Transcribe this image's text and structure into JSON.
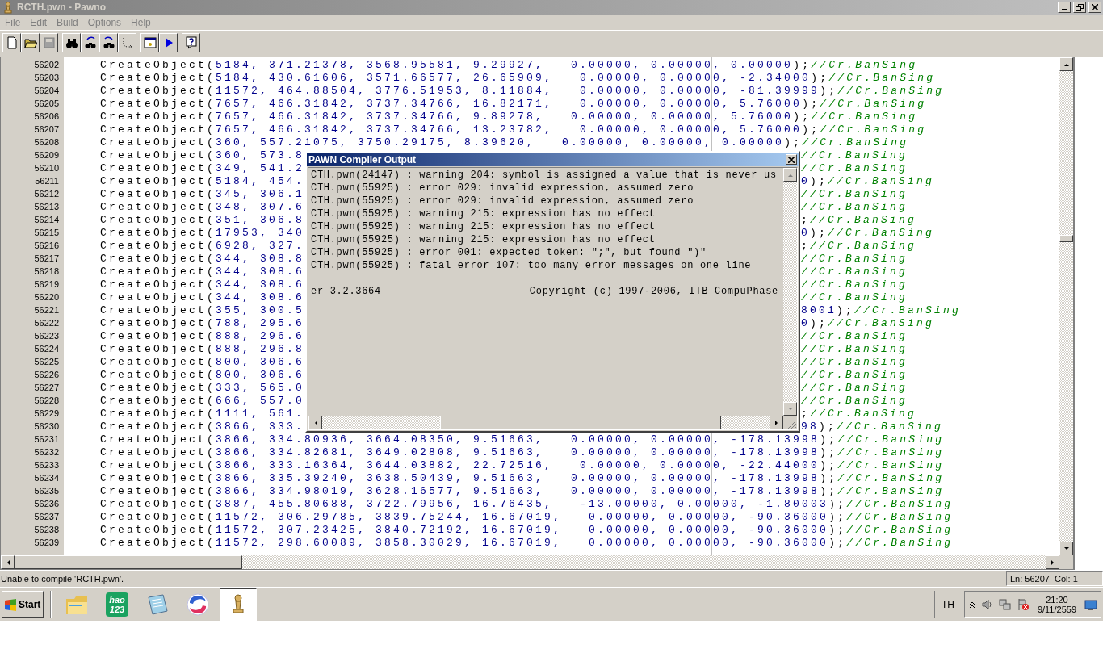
{
  "window": {
    "title": "RCTH.pwn - Pawno"
  },
  "menu": [
    "File",
    "Edit",
    "Build",
    "Options",
    "Help"
  ],
  "toolbar": [
    [
      {
        "kind": "new",
        "disabled": false
      },
      {
        "kind": "open",
        "disabled": false
      },
      {
        "kind": "save",
        "disabled": true
      }
    ],
    [
      {
        "kind": "find",
        "disabled": false
      },
      {
        "kind": "find-next",
        "disabled": false
      },
      {
        "kind": "replace",
        "disabled": false
      },
      {
        "kind": "goto",
        "disabled": false
      }
    ],
    [
      {
        "kind": "compile",
        "disabled": false
      },
      {
        "kind": "run",
        "disabled": false
      }
    ],
    [
      {
        "kind": "help",
        "disabled": false
      }
    ]
  ],
  "editor": {
    "lines": [
      {
        "number": "56202",
        "func": "CreateObject(",
        "args": "5184, 371.21378, 3568.95581, 9.29927,   0.00000, 0.00000, 0.00000",
        "end": ");",
        "comment": "//Cr.BanSing"
      },
      {
        "number": "56203",
        "func": "CreateObject(",
        "args": "5184, 430.61606, 3571.66577, 26.65909,   0.00000, 0.00000, -2.34000",
        "end": ");",
        "comment": "//Cr.BanSing"
      },
      {
        "number": "56204",
        "func": "CreateObject(",
        "args": "11572, 464.88504, 3776.51953, 8.11884,   0.00000, 0.00000, -81.39999",
        "end": ");",
        "comment": "//Cr.BanSing"
      },
      {
        "number": "56205",
        "func": "CreateObject(",
        "args": "7657, 466.31842, 3737.34766, 16.82171,   0.00000, 0.00000, 5.76000",
        "end": ");",
        "comment": "//Cr.BanSing"
      },
      {
        "number": "56206",
        "func": "CreateObject(",
        "args": "7657, 466.31842, 3737.34766, 9.89278,   0.00000, 0.00000, 5.76000",
        "end": ");",
        "comment": "//Cr.BanSing"
      },
      {
        "number": "56207",
        "func": "CreateObject(",
        "args": "7657, 466.31842, 3737.34766, 13.23782,   0.00000, 0.00000, 5.76000",
        "end": ");",
        "comment": "//Cr.BanSing"
      },
      {
        "number": "56208",
        "func": "CreateObject(",
        "args": "360, 557.21075, 3750.29175, 8.39620,   0.00000, 0.00000, 0.00000",
        "end": ");",
        "comment": "//Cr.BanSing"
      },
      {
        "number": "56209",
        "func": "CreateObject(",
        "args": "360, 573.8",
        "comment": "//Cr.BanSing"
      },
      {
        "number": "56210",
        "func": "CreateObject(",
        "args": "349, 541.2",
        "comment": "//Cr.BanSing"
      },
      {
        "number": "56211",
        "func": "CreateObject(",
        "args": "5184, 454.",
        "tail": {
          "args": "0",
          "end": ");"
        },
        "comment": "//Cr.BanSing"
      },
      {
        "number": "56212",
        "func": "CreateObject(",
        "args": "345, 306.1",
        "comment": "//Cr.BanSing"
      },
      {
        "number": "56213",
        "func": "CreateObject(",
        "args": "348, 307.6",
        "comment": "//Cr.BanSing"
      },
      {
        "number": "56214",
        "func": "CreateObject(",
        "args": "351, 306.8",
        "tail": {
          "end": ";"
        },
        "comment": "//Cr.BanSing"
      },
      {
        "number": "56215",
        "func": "CreateObject(",
        "args": "17953, 340",
        "tail": {
          "args": "0",
          "end": ");"
        },
        "comment": "//Cr.BanSing"
      },
      {
        "number": "56216",
        "func": "CreateObject(",
        "args": "6928, 327.",
        "tail": {
          "end": ";"
        },
        "comment": "//Cr.BanSing"
      },
      {
        "number": "56217",
        "func": "CreateObject(",
        "args": "344, 308.8",
        "comment": "//Cr.BanSing"
      },
      {
        "number": "56218",
        "func": "CreateObject(",
        "args": "344, 308.6",
        "comment": "//Cr.BanSing"
      },
      {
        "number": "56219",
        "func": "CreateObject(",
        "args": "344, 308.6",
        "comment": "//Cr.BanSing"
      },
      {
        "number": "56220",
        "func": "CreateObject(",
        "args": "344, 308.6",
        "comment": "//Cr.BanSing"
      },
      {
        "number": "56221",
        "func": "CreateObject(",
        "args": "355, 300.5",
        "tail": {
          "args": "8001",
          "end": ");"
        },
        "comment": "//Cr.BanSing"
      },
      {
        "number": "56222",
        "func": "CreateObject(",
        "args": "788, 295.6",
        "tail": {
          "args": "0",
          "end": ");"
        },
        "comment": "//Cr.BanSing"
      },
      {
        "number": "56223",
        "func": "CreateObject(",
        "args": "888, 296.6",
        "comment": "//Cr.BanSing"
      },
      {
        "number": "56224",
        "func": "CreateObject(",
        "args": "888, 296.8",
        "comment": "//Cr.BanSing"
      },
      {
        "number": "56225",
        "func": "CreateObject(",
        "args": "800, 306.6",
        "comment": "//Cr.BanSing"
      },
      {
        "number": "56226",
        "func": "CreateObject(",
        "args": "800, 306.6",
        "comment": "//Cr.BanSing"
      },
      {
        "number": "56227",
        "func": "CreateObject(",
        "args": "333, 565.0",
        "comment": "//Cr.BanSing"
      },
      {
        "number": "56228",
        "func": "CreateObject(",
        "args": "666, 557.0",
        "comment": "//Cr.BanSing"
      },
      {
        "number": "56229",
        "func": "CreateObject(",
        "args": "1111, 561.",
        "tail": {
          "end": ";"
        },
        "comment": "//Cr.BanSing"
      },
      {
        "number": "56230",
        "func": "CreateObject(",
        "args": "3866, 333.",
        "tail": {
          "args": "98",
          "end": ");"
        },
        "comment": "//Cr.BanSing"
      },
      {
        "number": "56231",
        "func": "CreateObject(",
        "args": "3866, 334.80936, 3664.08350, 9.51663,   0.00000, 0.00000, -178.13998",
        "end": ");",
        "comment": "//Cr.BanSing"
      },
      {
        "number": "56232",
        "func": "CreateObject(",
        "args": "3866, 334.82681, 3649.02808, 9.51663,   0.00000, 0.00000, -178.13998",
        "end": ");",
        "comment": "//Cr.BanSing"
      },
      {
        "number": "56233",
        "func": "CreateObject(",
        "args": "3866, 333.16364, 3644.03882, 22.72516,   0.00000, 0.00000, -22.44000",
        "end": ");",
        "comment": "//Cr.BanSing"
      },
      {
        "number": "56234",
        "func": "CreateObject(",
        "args": "3866, 335.39240, 3638.50439, 9.51663,   0.00000, 0.00000, -178.13998",
        "end": ");",
        "comment": "//Cr.BanSing"
      },
      {
        "number": "56235",
        "func": "CreateObject(",
        "args": "3866, 334.98019, 3628.16577, 9.51663,   0.00000, 0.00000, -178.13998",
        "end": ");",
        "comment": "//Cr.BanSing"
      },
      {
        "number": "56236",
        "func": "CreateObject(",
        "args": "3887, 455.80688, 3722.79956, 16.76435,   -13.00000, 0.00000, -1.80003",
        "end": ");",
        "comment": "//Cr.BanSing"
      },
      {
        "number": "56237",
        "func": "CreateObject(",
        "args": "11572, 306.29785, 3839.75244, 16.67019,   0.00000, 0.00000, -90.36000",
        "end": ");",
        "comment": "//Cr.BanSing"
      },
      {
        "number": "56238",
        "func": "CreateObject(",
        "args": "11572, 307.23425, 3840.72192, 16.67019,   0.00000, 0.00000, -90.36000",
        "end": ");",
        "comment": "//Cr.BanSing"
      },
      {
        "number": "56239",
        "func": "CreateObject(",
        "args": "11572, 298.60089, 3858.30029, 16.67019,   0.00000, 0.00000, -90.36000",
        "end": ");",
        "comment": "//Cr.BanSing"
      }
    ]
  },
  "compiler_output": {
    "title": "PAWN Compiler Output",
    "lines": [
      "CTH.pwn(24147) : warning 204: symbol is assigned a value that is never us",
      "CTH.pwn(55925) : error 029: invalid expression, assumed zero",
      "CTH.pwn(55925) : error 029: invalid expression, assumed zero",
      "CTH.pwn(55925) : warning 215: expression has no effect",
      "CTH.pwn(55925) : warning 215: expression has no effect",
      "CTH.pwn(55925) : warning 215: expression has no effect",
      "CTH.pwn(55925) : error 001: expected token: \";\", but found \")\"",
      "CTH.pwn(55925) : fatal error 107: too many error messages on one line"
    ],
    "version": "er 3.2.3664",
    "copyright": "Copyright (c) 1997-2006, ITB CompuPhase"
  },
  "status_bar": {
    "message": "Unable to compile 'RCTH.pwn'.",
    "position": "Ln: 56207  Col: 1"
  },
  "taskbar": {
    "start": "Start",
    "apps": [
      {
        "kind": "folder",
        "selected": false
      },
      {
        "kind": "hao123",
        "label": [
          "hao",
          "123"
        ],
        "selected": false
      },
      {
        "kind": "notepad",
        "selected": false
      },
      {
        "kind": "browser",
        "selected": false
      },
      {
        "kind": "pawn",
        "selected": true
      }
    ],
    "language": "TH",
    "time": "21:20",
    "date": "9/11/2559"
  }
}
